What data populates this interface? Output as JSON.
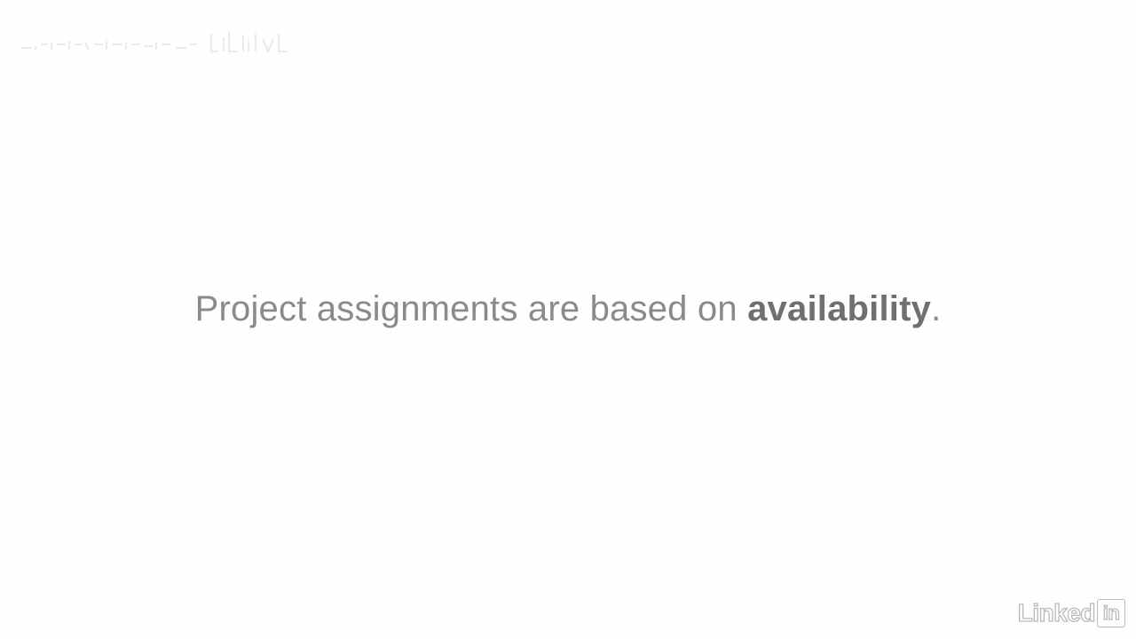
{
  "caption": {
    "prefix": "Project assignments are based on ",
    "emphasis": "availability",
    "suffix": "."
  },
  "brand": {
    "word": "Linked",
    "box": "in"
  },
  "colors": {
    "background": "#fefefe",
    "caption_text": "#8a8a8a",
    "caption_emphasis": "#6f6f6f",
    "brand_outline": "#b9b9b9"
  },
  "icons": {
    "top_left": "faint-watermark-logo",
    "brand": "linkedin-logo"
  }
}
